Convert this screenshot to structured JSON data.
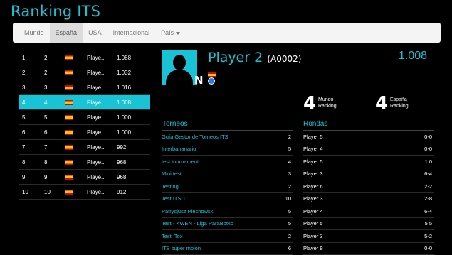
{
  "title": "Ranking ITS",
  "tabs": [
    "Mundo",
    "España",
    "USA",
    "Internacional",
    "País"
  ],
  "ranking": [
    {
      "world": "1",
      "country": "2",
      "name": "Playe...",
      "score": "1.088"
    },
    {
      "world": "2",
      "country": "2",
      "name": "Playe...",
      "score": "1.032"
    },
    {
      "world": "3",
      "country": "3",
      "name": "Playe...",
      "score": "1.016"
    },
    {
      "world": "4",
      "country": "4",
      "name": "Playe...",
      "score": "1.008"
    },
    {
      "world": "5",
      "country": "5",
      "name": "Playe...",
      "score": "1.000"
    },
    {
      "world": "6",
      "country": "6",
      "name": "Playe...",
      "score": "1.000"
    },
    {
      "world": "7",
      "country": "7",
      "name": "Playe...",
      "score": "992"
    },
    {
      "world": "8",
      "country": "8",
      "name": "Playe...",
      "score": "968"
    },
    {
      "world": "9",
      "country": "9",
      "name": "Playe...",
      "score": "968"
    },
    {
      "world": "10",
      "country": "10",
      "name": "Playe...",
      "score": "912"
    }
  ],
  "player": {
    "name": "Player 2",
    "code": "(A0002)",
    "score": "1.008",
    "logo": "N",
    "world_rank": "4",
    "world_label_1": "Mundo",
    "world_label_2": "Ranking",
    "country_rank": "4",
    "country_label_1": "España",
    "country_label_2": "Ranking"
  },
  "torneos_title": "Torneos",
  "rondas_title": "Rondas",
  "torneos": [
    {
      "name": "Guía Gestor de Torneos ITS",
      "value": "2"
    },
    {
      "name": "Interbananario",
      "value": "5"
    },
    {
      "name": "test tournament",
      "value": "4"
    },
    {
      "name": "Mini test",
      "value": "3"
    },
    {
      "name": "Testing",
      "value": "2"
    },
    {
      "name": "Test ITS 1",
      "value": "10"
    },
    {
      "name": "Patrycjusz Piechowski",
      "value": "5"
    },
    {
      "name": "Test - KWEN - Liga ParaBotxo",
      "value": "5"
    },
    {
      "name": "Test_Tox",
      "value": "2"
    },
    {
      "name": "ITS super molon",
      "value": "6"
    }
  ],
  "rondas": [
    {
      "name": "Player 5",
      "score": "0-0"
    },
    {
      "name": "Player 4",
      "score": "0-0"
    },
    {
      "name": "Player 5",
      "score": "1 0"
    },
    {
      "name": "Player 3",
      "score": "6-4"
    },
    {
      "name": "Player 6",
      "score": "2-2"
    },
    {
      "name": "Player 3",
      "score": "2-8"
    },
    {
      "name": "Player 4",
      "score": "6-4"
    },
    {
      "name": "Player 5",
      "score": "5 5"
    },
    {
      "name": "Player 3",
      "score": "5-2"
    },
    {
      "name": "Player 9",
      "score": "0-0"
    }
  ],
  "colors": {
    "accent": "#19c3d6",
    "background": "#000000"
  },
  "selected_index": 3
}
